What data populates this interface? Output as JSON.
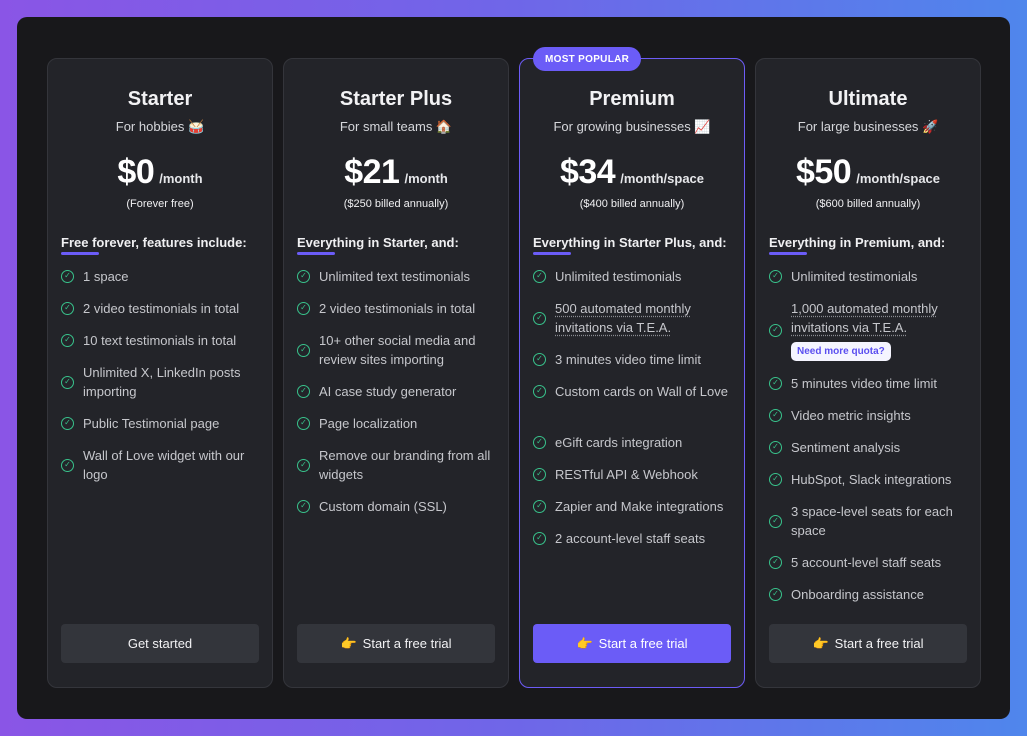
{
  "badge": "MOST POPULAR",
  "plans": [
    {
      "name": "Starter",
      "tagline": "For hobbies 🥁",
      "price": "$0",
      "per": "/month",
      "billing": "(Forever free)",
      "features_heading": "Free forever, features include:",
      "features": [
        "1 space",
        "2 video testimonials in total",
        "10 text testimonials in total",
        "Unlimited X, LinkedIn posts importing",
        "Public Testimonial page",
        "Wall of Love widget with our logo"
      ],
      "cta_icon": "",
      "cta": "Get started"
    },
    {
      "name": "Starter Plus",
      "tagline": "For small teams 🏠",
      "price": "$21",
      "per": "/month",
      "billing": "($250 billed annually)",
      "features_heading": "Everything in Starter, and:",
      "features": [
        "Unlimited text testimonials",
        "2 video testimonials in total",
        "10+ other social media and review sites importing",
        "AI case study generator",
        "Page localization",
        "Remove our branding from all widgets",
        "Custom domain (SSL)"
      ],
      "cta_icon": "👉",
      "cta": "Start a free trial"
    },
    {
      "name": "Premium",
      "tagline": "For growing businesses 📈",
      "price": "$34",
      "per": "/month/space",
      "billing": "($400 billed annually)",
      "features_heading": "Everything in Starter Plus, and:",
      "features": [
        "Unlimited testimonials",
        "500 automated monthly invitations via T.E.A.",
        "3 minutes video time limit",
        "Custom cards on Wall of Love",
        "eGift cards integration",
        "RESTful API & Webhook",
        "Zapier and Make integrations",
        "2 account-level staff seats"
      ],
      "cta_icon": "👉",
      "cta": "Start a free trial"
    },
    {
      "name": "Ultimate",
      "tagline": "For large businesses 🚀",
      "price": "$50",
      "per": "/month/space",
      "billing": "($600 billed annually)",
      "features_heading": "Everything in Premium, and:",
      "features": [
        "Unlimited testimonials",
        "1,000 automated monthly invitations via T.E.A.",
        "5 minutes video time limit",
        "Video metric insights",
        "Sentiment analysis",
        "HubSpot, Slack integrations",
        "3 space-level seats for each space",
        "5 account-level staff seats",
        "Onboarding assistance"
      ],
      "quota_link": "Need more quota?",
      "cta_icon": "👉",
      "cta": "Start a free trial"
    }
  ],
  "colors": {
    "accent": "#6b5cf7",
    "check": "#38c28b",
    "card_bg": "#232429",
    "panel_bg": "#18181b"
  }
}
